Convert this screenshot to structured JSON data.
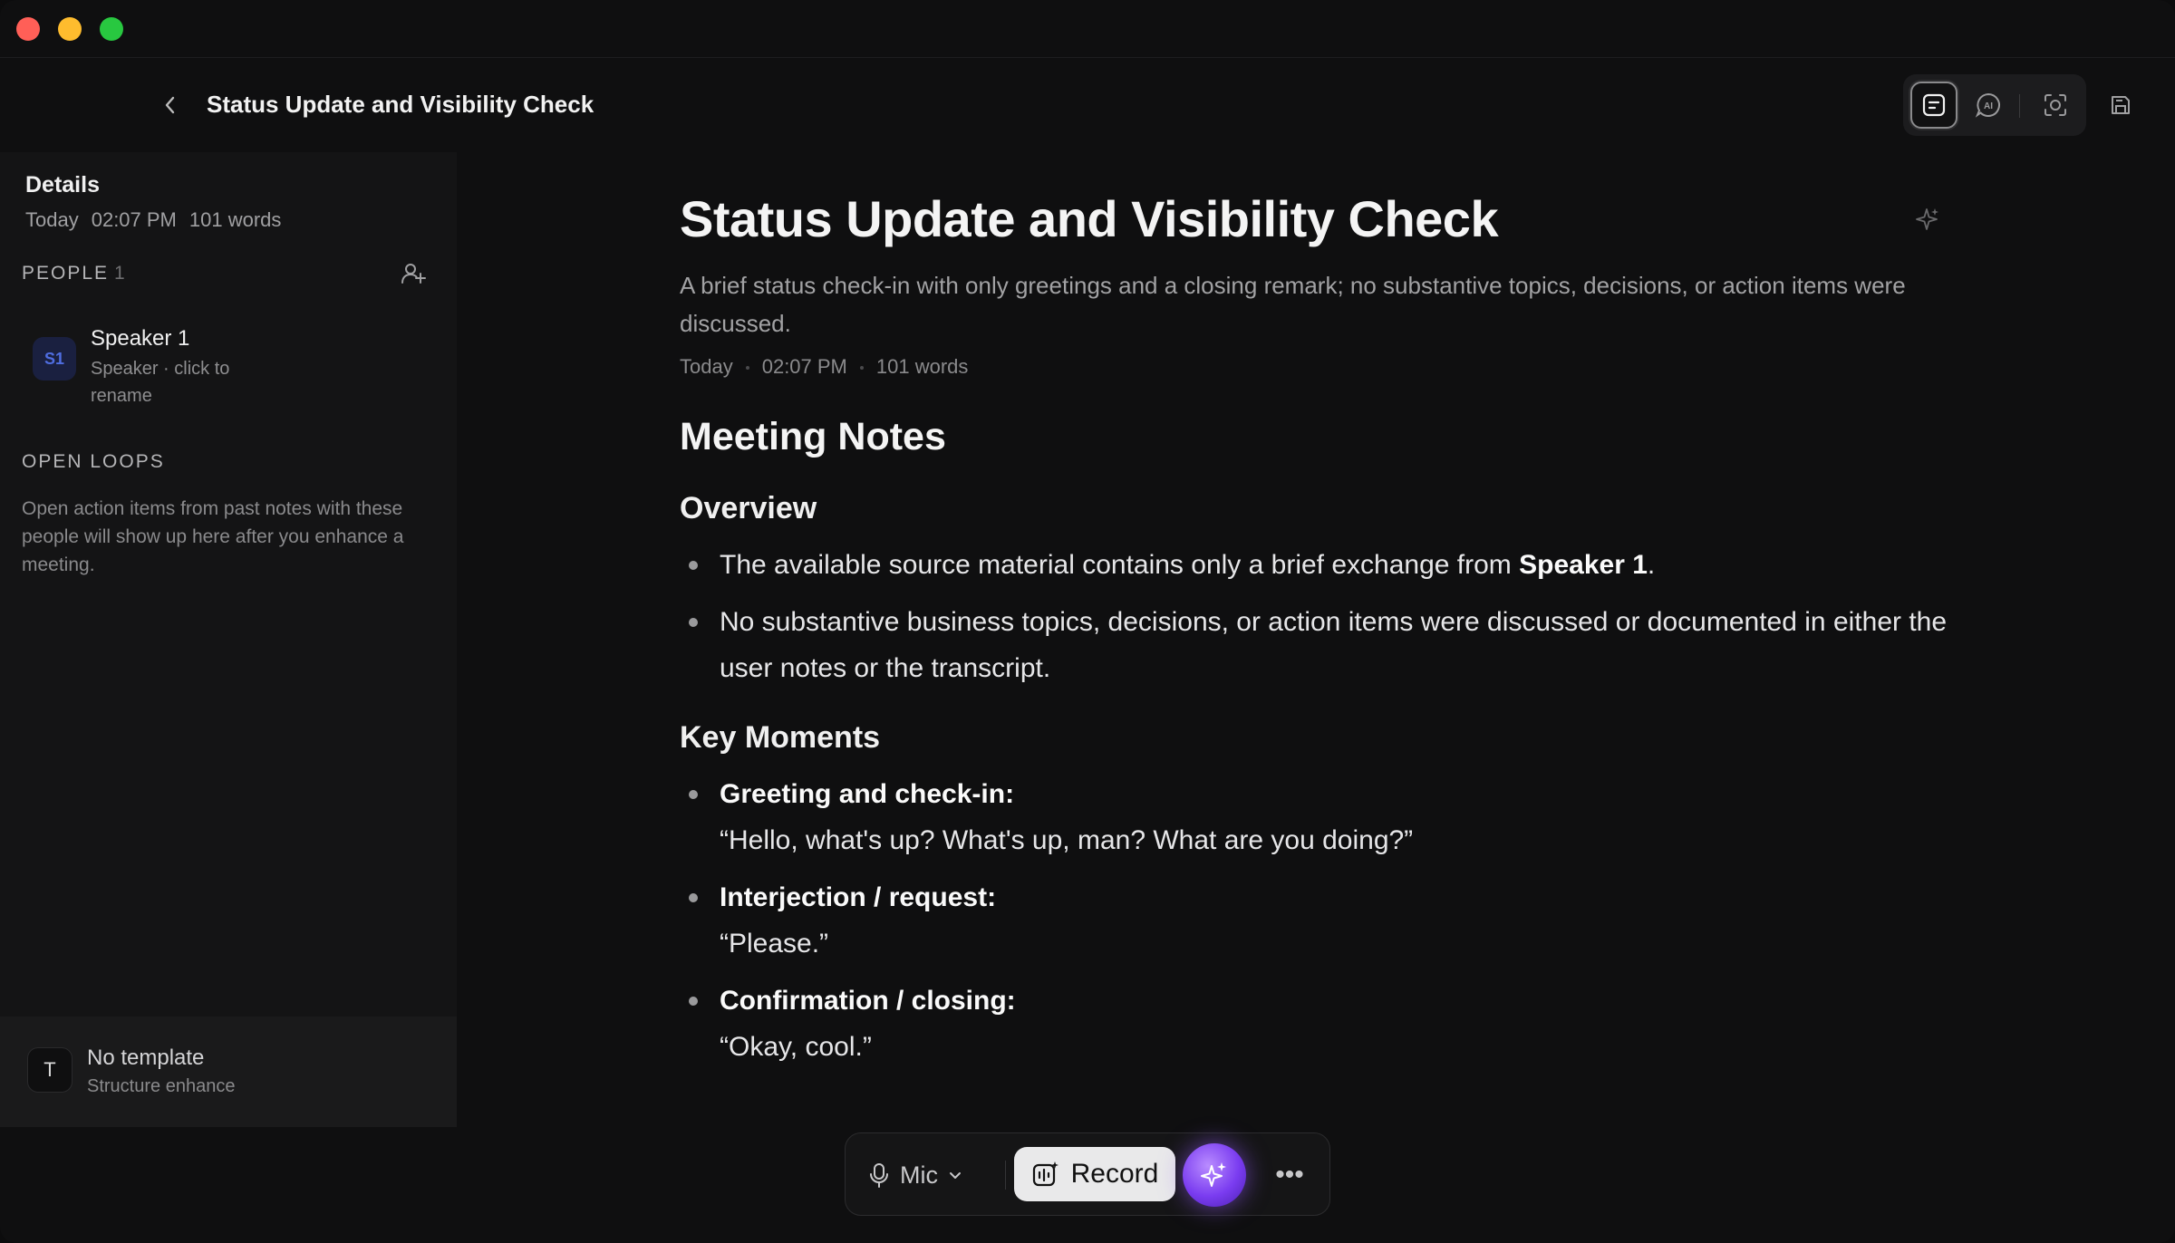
{
  "window": {
    "title_top": "Status Update and Visibility Check"
  },
  "sidebar": {
    "details_label": "Details",
    "meta": {
      "date": "Today",
      "time": "02:07 PM",
      "words": "101 words"
    },
    "people_label": "PEOPLE",
    "people_count": "1",
    "speaker": {
      "avatar": "S1",
      "name": "Speaker 1",
      "subtitle": "Speaker · click to rename"
    },
    "open_loops_label": "OPEN LOOPS",
    "open_loops_text": "Open action items from past notes with these people will show up here after you enhance a meeting.",
    "template": {
      "icon_letter": "T",
      "title": "No template",
      "subtitle": "Structure enhance"
    }
  },
  "document": {
    "title": "Status Update and Visibility Check",
    "summary": "A brief status check-in with only greetings and a closing remark; no substantive topics, decisions, or action items were discussed.",
    "meta": {
      "date": "Today",
      "time": "02:07 PM",
      "words": "101 words"
    },
    "heading": "Meeting Notes",
    "overview_heading": "Overview",
    "overview": [
      {
        "pre": "The available source material contains only a brief exchange from ",
        "bold": "Speaker 1",
        "post": "."
      },
      {
        "text": "No substantive business topics, decisions, or action items were discussed or documented in either the user notes or the transcript."
      }
    ],
    "key_moments_heading": "Key Moments",
    "key_moments": [
      {
        "label": "Greeting and check-in:",
        "quote": "“Hello, what's up? What's up, man? What are you doing?”"
      },
      {
        "label": "Interjection / request:",
        "quote": "“Please.”"
      },
      {
        "label": "Confirmation / closing:",
        "quote": "“Okay, cool.”"
      }
    ]
  },
  "bottombar": {
    "mic_label": "Mic",
    "record_label": "Record",
    "more_label": "•••"
  },
  "icons": {
    "back": "chevron-left-icon",
    "notes_view": "notes-view-icon",
    "ai_chat": "ai-chat-icon",
    "screenshot": "screenshot-icon",
    "save": "save-icon",
    "add_person": "add-person-icon",
    "sparkle": "sparkle-icon",
    "mic": "microphone-icon",
    "record": "record-waveform-icon"
  },
  "colors": {
    "accent_purple": "#7a3cf0",
    "background": "#0f0f10",
    "sidebar": "#141415"
  }
}
